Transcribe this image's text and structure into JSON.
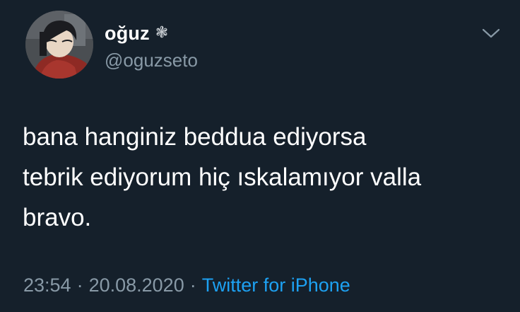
{
  "author": {
    "display_name": "oğuz",
    "name_emoji": "❃",
    "handle": "@oguzseto"
  },
  "tweet": {
    "lines": [
      "bana hanginiz beddua ediyorsa",
      "tebrik ediyorum hiç ıskalamıyor valla",
      "bravo."
    ]
  },
  "meta": {
    "time": "23:54",
    "separator": "·",
    "date": "20.08.2020",
    "source": "Twitter for iPhone"
  },
  "icons": {
    "caret": "chevron-down-icon",
    "avatar": "avatar-illustration"
  },
  "colors": {
    "background": "#15202b",
    "text": "#ffffff",
    "secondary": "#8899a6",
    "link": "#1da1f2"
  }
}
